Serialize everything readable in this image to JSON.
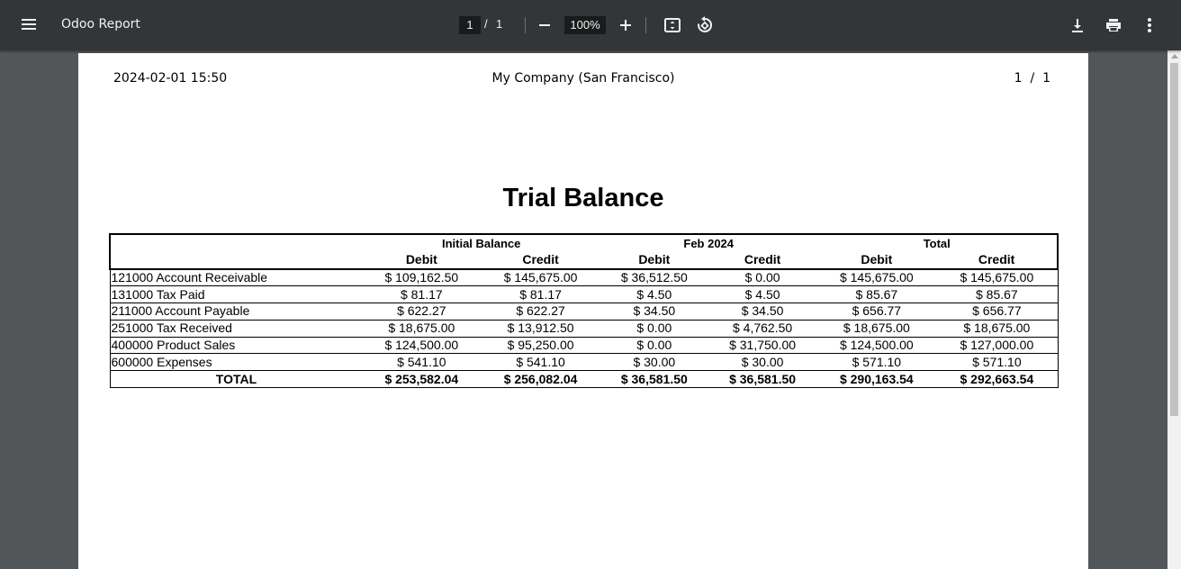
{
  "toolbar": {
    "title": "Odoo Report",
    "page_current": "1",
    "page_separator": "/",
    "page_total": "1",
    "zoom": "100%",
    "icons": [
      "menu-icon",
      "zoom-out-icon",
      "zoom-in-icon",
      "fit-page-icon",
      "rotate-icon",
      "download-icon",
      "print-icon",
      "more-vert-icon"
    ]
  },
  "report": {
    "date": "2024-02-01 15:50",
    "company": "My Company (San Francisco)",
    "page_number": "1  /  1",
    "title": "Trial Balance",
    "groups": [
      "Initial Balance",
      "Feb 2024",
      "Total"
    ],
    "sub_headers": [
      "Debit",
      "Credit",
      "Debit",
      "Credit",
      "Debit",
      "Credit"
    ],
    "rows": [
      {
        "account": "121000 Account Receivable",
        "values": [
          "$ 109,162.50",
          "$ 145,675.00",
          "$ 36,512.50",
          "$ 0.00",
          "$ 145,675.00",
          "$ 145,675.00"
        ]
      },
      {
        "account": "131000 Tax Paid",
        "values": [
          "$ 81.17",
          "$ 81.17",
          "$ 4.50",
          "$ 4.50",
          "$ 85.67",
          "$ 85.67"
        ]
      },
      {
        "account": "211000 Account Payable",
        "values": [
          "$ 622.27",
          "$ 622.27",
          "$ 34.50",
          "$ 34.50",
          "$ 656.77",
          "$ 656.77"
        ]
      },
      {
        "account": "251000 Tax Received",
        "values": [
          "$ 18,675.00",
          "$ 13,912.50",
          "$ 0.00",
          "$ 4,762.50",
          "$ 18,675.00",
          "$ 18,675.00"
        ]
      },
      {
        "account": "400000 Product Sales",
        "values": [
          "$ 124,500.00",
          "$ 95,250.00",
          "$ 0.00",
          "$ 31,750.00",
          "$ 124,500.00",
          "$ 127,000.00"
        ]
      },
      {
        "account": "600000 Expenses",
        "values": [
          "$ 541.10",
          "$ 541.10",
          "$ 30.00",
          "$ 30.00",
          "$ 571.10",
          "$ 571.10"
        ]
      }
    ],
    "total": {
      "label": "TOTAL",
      "values": [
        "$ 253,582.04",
        "$ 256,082.04",
        "$ 36,581.50",
        "$ 36,581.50",
        "$ 290,163.54",
        "$ 292,663.54"
      ]
    }
  }
}
